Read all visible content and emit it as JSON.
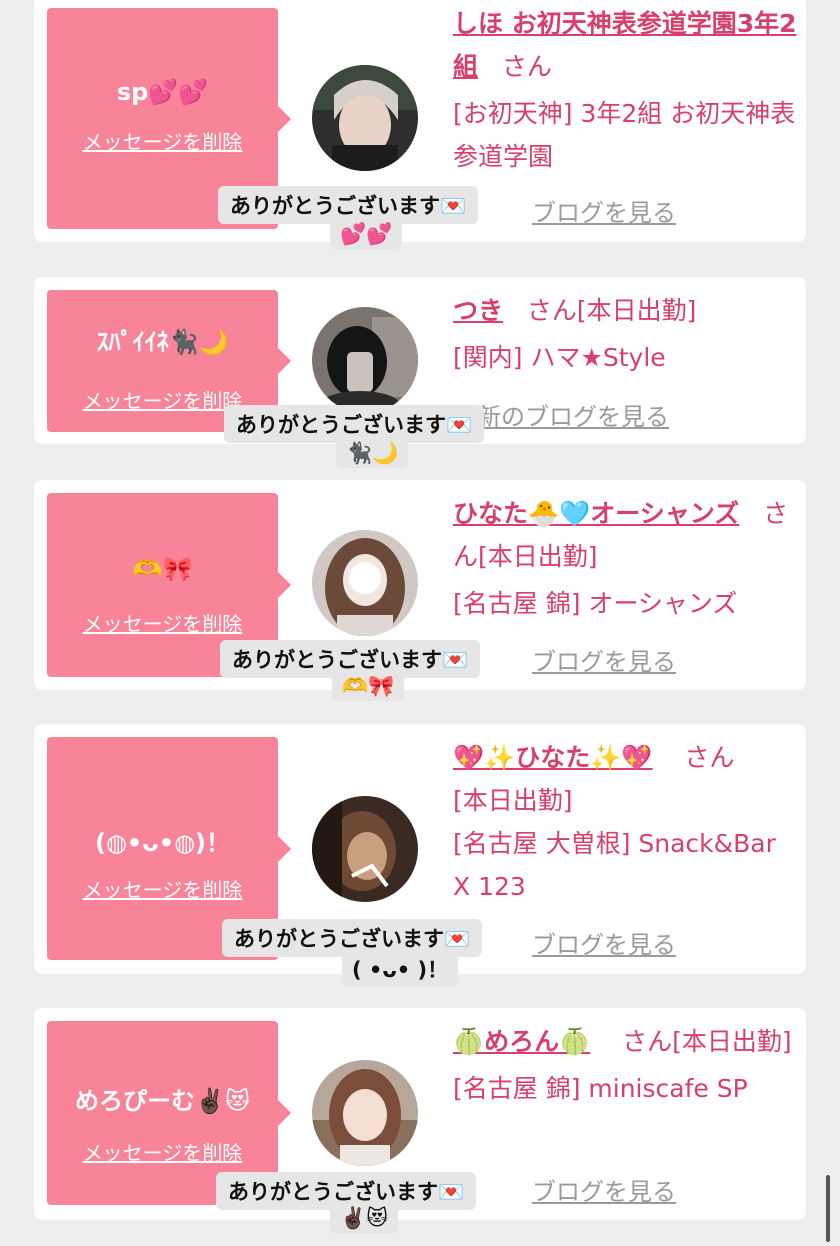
{
  "delete_label": "メッセージを削除",
  "thanks_label": "ありがとうございます💌",
  "blog_label": "ブログを見る",
  "blog_label_full": "最新のブログを見る",
  "san_label": "さん",
  "cards": [
    {
      "message": "sp💕💕",
      "name": "しほ お初天神表参道学園3年2組",
      "badge": "",
      "shop": "[お初天神] 3年2組 お初天神表参道学園",
      "sub": "💕💕"
    },
    {
      "message": "ｽﾊﾟｲｲﾈ🐈‍⬛🌙",
      "name": "つき",
      "badge": "[本日出勤]",
      "shop": "[関内] ハマ★Style",
      "sub": "🐈‍⬛🌙"
    },
    {
      "message": "🫶🎀",
      "name": "ひなた🐣🩵オーシャンズ",
      "badge": "[本日出勤]",
      "shop": "[名古屋 錦] オーシャンズ",
      "sub": "🫶🎀"
    },
    {
      "message": "(◍•ᴗ•◍)！",
      "name": "💖✨ひなた✨💖",
      "badge": "[本日出勤]",
      "shop": "[名古屋 大曽根] Snack&Bar X 123",
      "sub": "( •ᴗ• )！"
    },
    {
      "message": "めろぴーむ✌🏿😻",
      "name": "🍈めろん🍈",
      "badge": "[本日出勤]",
      "shop": "[名古屋 錦] miniscafe SP",
      "sub": "✌🏿😻"
    }
  ]
}
